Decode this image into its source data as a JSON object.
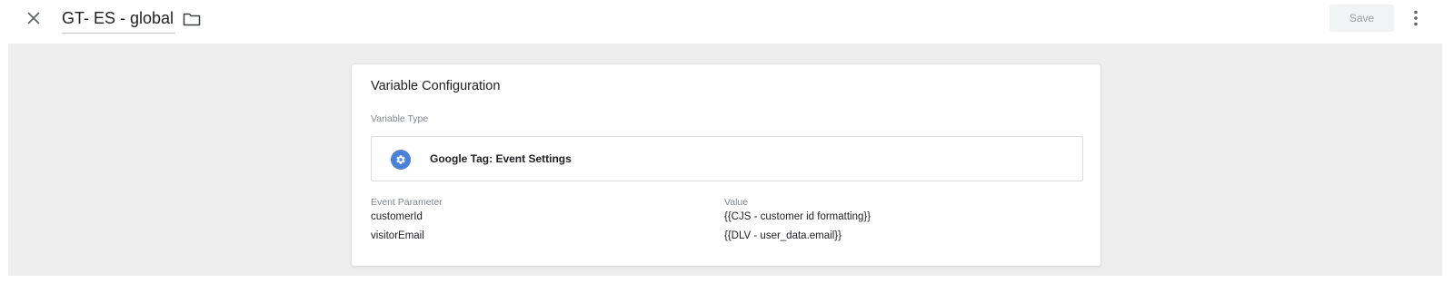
{
  "header": {
    "close_icon": "close-icon",
    "title": "GT- ES - global",
    "folder_icon": "folder-icon",
    "save_label": "Save",
    "more_icon": "more-vert-icon"
  },
  "card": {
    "title": "Variable Configuration",
    "variable_type_label": "Variable Type",
    "variable_type": {
      "icon": "gear-icon",
      "name": "Google Tag: Event Settings"
    },
    "table": {
      "headers": [
        "Event Parameter",
        "Value"
      ],
      "rows": [
        [
          "customerId",
          "{{CJS - customer id formatting}}"
        ],
        [
          "visitorEmail",
          "{{DLV - user_data.email}}"
        ]
      ]
    }
  },
  "colors": {
    "accent": "#4a81d8",
    "content_bg": "#eeeeee",
    "save_disabled_bg": "#f1f3f4"
  }
}
